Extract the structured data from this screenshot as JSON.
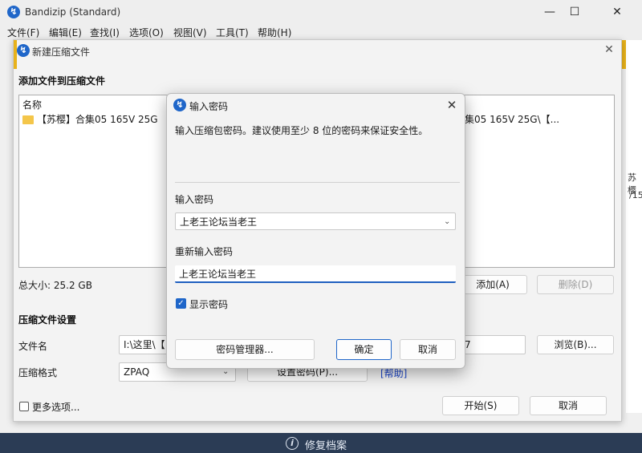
{
  "window": {
    "title": "Bandizip (Standard)",
    "minimize_glyph": "—",
    "maximize_glyph": "☐",
    "close_glyph": "✕"
  },
  "menu": [
    "文件(F)",
    "编辑(E)",
    "查找(I)",
    "选项(O)",
    "视图(V)",
    "工具(T)",
    "帮助(H)"
  ],
  "right_strip": [
    "苏樱",
    "/15"
  ],
  "new_archive": {
    "title": "新建压缩文件",
    "section_add": "添加文件到压缩文件",
    "list_header": "名称",
    "file_name": "【苏樱】合集05 165V 25G",
    "file_path_partial": "集05 165V 25G\\【...",
    "total_size": "总大小: 25.2 GB",
    "add_button": "添加(A)",
    "delete_button": "删除(D)",
    "settings_header": "压缩文件设置",
    "filename_label": "文件名",
    "filename_value": "I:\\这里\\【",
    "filename_tail": "7",
    "browse_button": "浏览(B)...",
    "format_label": "压缩格式",
    "format_value": "ZPAQ",
    "set_password_button": "设置密码(P)...",
    "help_link": "[帮助]",
    "more_options": "更多选项...",
    "start_button": "开始(S)",
    "cancel_button": "取消"
  },
  "status_bar": {
    "repair_label": "修复档案"
  },
  "password_dialog": {
    "title": "输入密码",
    "message": "输入压缩包密码。建议使用至少 8 位的密码来保证安全性。",
    "password_label": "输入密码",
    "password_value": "上老王论坛当老王",
    "reenter_label": "重新输入密码",
    "reenter_value": "上老王论坛当老王",
    "show_password_label": "显示密码",
    "show_password_checked": true,
    "manager_button": "密码管理器...",
    "ok_button": "确定",
    "cancel_button": "取消"
  },
  "colors": {
    "accent": "#1f66c9",
    "warning_strip": "#e8b21a",
    "taskbar": "#2b3c55"
  }
}
